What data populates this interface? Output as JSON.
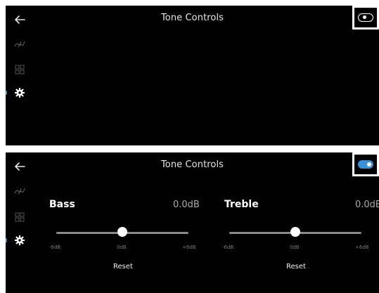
{
  "screens": [
    {
      "title": "Tone Controls",
      "toggle": {
        "state": "off"
      }
    },
    {
      "title": "Tone Controls",
      "toggle": {
        "state": "on"
      },
      "bass": {
        "label": "Bass",
        "value": "0.0dB",
        "position": 0.5,
        "ticks": [
          "-6dB",
          "0dB",
          "+6dB"
        ],
        "reset_label": "Reset"
      },
      "treble": {
        "label": "Treble",
        "value": "0.0dB",
        "position": 0.5,
        "ticks": [
          "-6dB",
          "0dB",
          "+6dB"
        ],
        "reset_label": "Reset"
      }
    }
  ],
  "sidebar": {
    "items": [
      {
        "icon": "waveform-icon",
        "active": false
      },
      {
        "icon": "grid-icon",
        "active": false
      },
      {
        "icon": "gear-icon",
        "active": true
      }
    ]
  },
  "colors": {
    "background": "#000000",
    "accent": "#3a8fd9",
    "muted_text": "#a9a9a9"
  }
}
